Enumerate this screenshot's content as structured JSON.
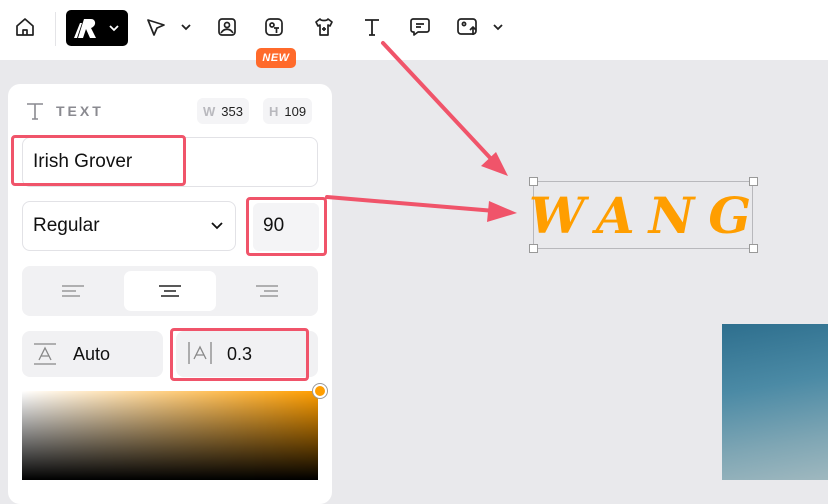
{
  "toolbar": {
    "new_badge": "NEW",
    "icons": [
      "home-icon",
      "logo-icon",
      "chevron-down-icon",
      "select-arrow-icon",
      "chevron-down-icon",
      "image-icon",
      "sticker-icon",
      "shirt-icon",
      "text-icon",
      "comment-icon",
      "upload-icon",
      "chevron-down-icon"
    ]
  },
  "text_panel": {
    "title": "TEXT",
    "width_label": "W",
    "width_value": "353",
    "height_label": "H",
    "height_value": "109",
    "font_name": "Irish Grover",
    "font_style": "Regular",
    "font_size": "90",
    "line_height": "Auto",
    "letter_spacing": "0.3",
    "accent_color": "#ff9e00"
  },
  "canvas": {
    "text": "WANG",
    "text_color": "#ff9e00"
  },
  "annotation_color": "#f0546a"
}
